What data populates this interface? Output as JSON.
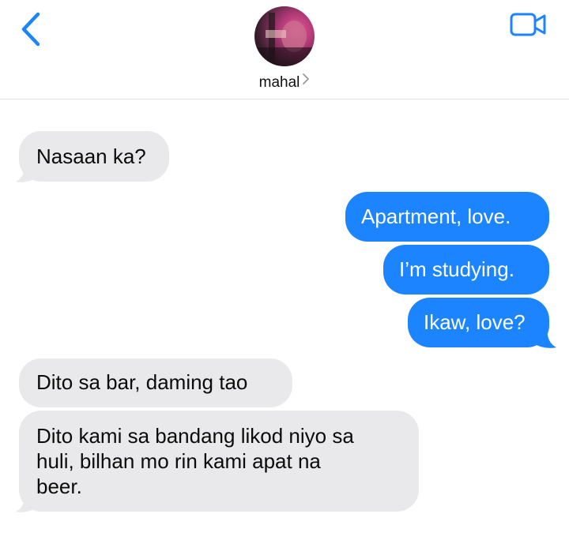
{
  "header": {
    "contact_name": "mahal"
  },
  "icons": {
    "back": "chevron-left-icon",
    "contact_chevron": "chevron-right-icon",
    "video": "video-camera-icon",
    "avatar": "avatar"
  },
  "colors": {
    "accent": "#1c84fe",
    "received_bubble": "#e9e9eb",
    "sent_text": "#ffffff",
    "received_text": "#0b0b0b"
  },
  "messages": [
    {
      "direction": "received",
      "text": "Nasaan ka?"
    },
    {
      "direction": "sent",
      "text": "Apartment, love."
    },
    {
      "direction": "sent",
      "text": "I’m studying."
    },
    {
      "direction": "sent",
      "text": "Ikaw, love?"
    },
    {
      "direction": "received",
      "text": "Dito sa bar, daming tao"
    },
    {
      "direction": "received",
      "lines": [
        "Dito kami sa bandang likod niyo sa",
        "huli, bilhan mo rin kami apat na",
        "beer."
      ]
    }
  ]
}
